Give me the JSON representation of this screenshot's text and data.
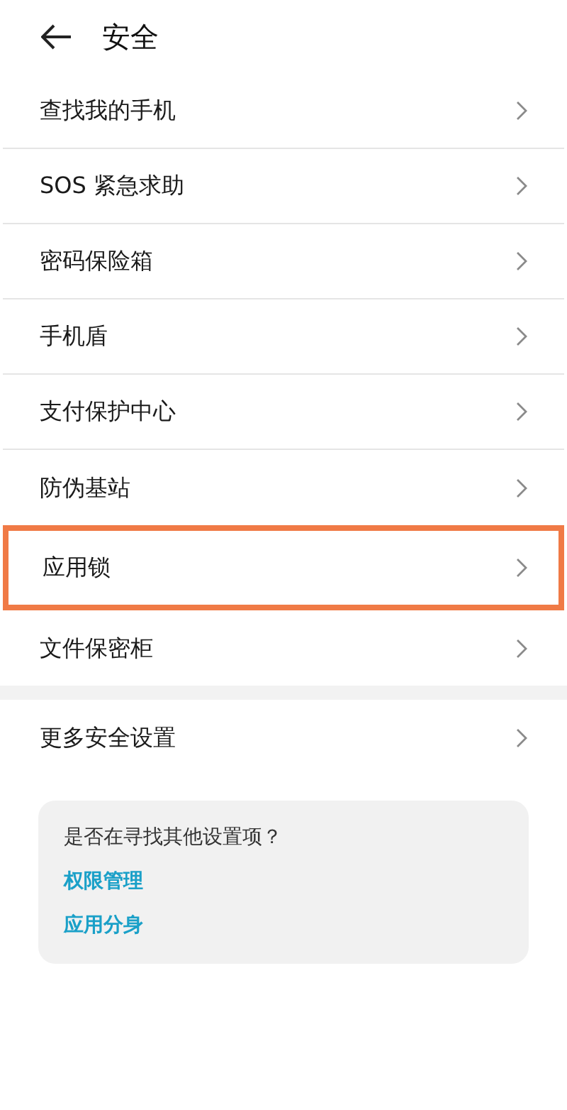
{
  "header": {
    "title": "安全"
  },
  "sections": [
    {
      "items": [
        {
          "label": "查找我的手机",
          "highlighted": false
        },
        {
          "label": "SOS 紧急求助",
          "highlighted": false
        },
        {
          "label": "密码保险箱",
          "highlighted": false
        },
        {
          "label": "手机盾",
          "highlighted": false
        },
        {
          "label": "支付保护中心",
          "highlighted": false
        },
        {
          "label": "防伪基站",
          "highlighted": false
        },
        {
          "label": "应用锁",
          "highlighted": true
        },
        {
          "label": "文件保密柜",
          "highlighted": false
        }
      ]
    },
    {
      "items": [
        {
          "label": "更多安全设置",
          "highlighted": false
        }
      ]
    }
  ],
  "suggestion_card": {
    "question": "是否在寻找其他设置项？",
    "links": [
      "权限管理",
      "应用分身"
    ]
  }
}
